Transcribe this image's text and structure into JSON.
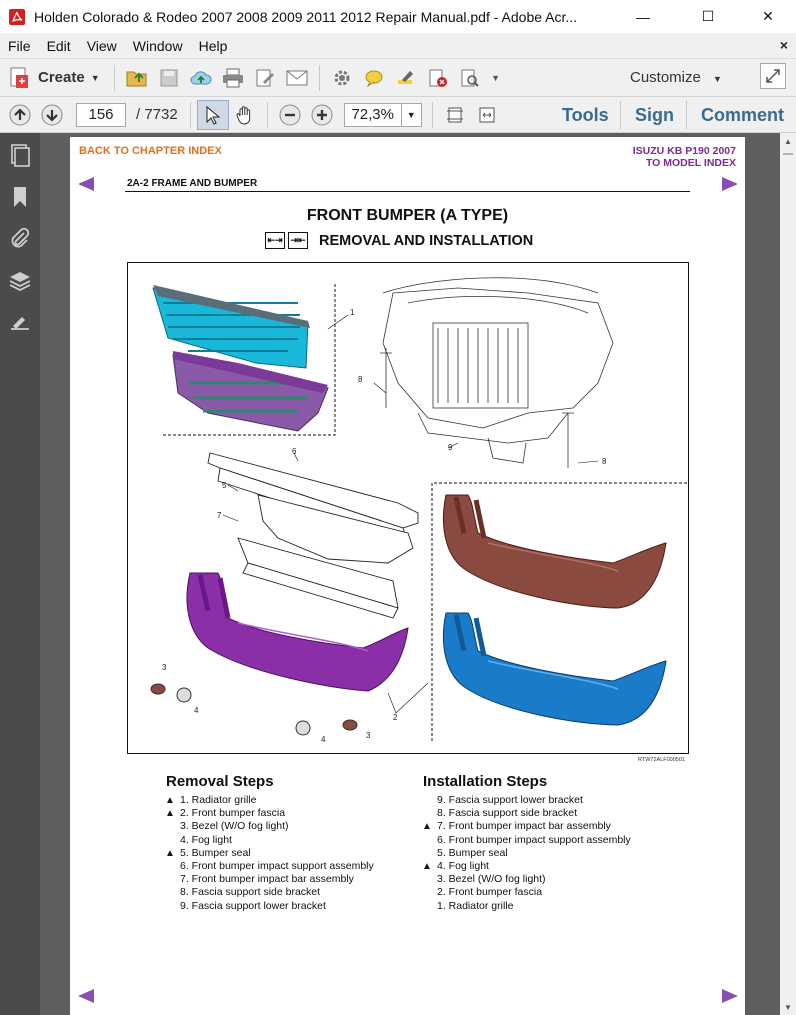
{
  "window": {
    "title": "Holden Colorado & Rodeo 2007 2008 2009 2011 2012 Repair Manual.pdf - Adobe Acr...",
    "minimize": "—",
    "maximize": "☐",
    "close": "✕"
  },
  "menu": {
    "items": [
      "File",
      "Edit",
      "View",
      "Window",
      "Help"
    ],
    "close": "×"
  },
  "toolbar": {
    "create_label": "Create",
    "customize_label": "Customize"
  },
  "nav": {
    "page_number": "156",
    "page_total": "/ 7732",
    "zoom": "72,3%",
    "tools_label": "Tools",
    "sign_label": "Sign",
    "comment_label": "Comment"
  },
  "page": {
    "back_link": "BACK TO CHAPTER INDEX",
    "model_line1": "ISUZU KB P190 2007",
    "model_line2": "TO MODEL INDEX",
    "section": "2A-2  FRAME AND BUMPER",
    "title": "FRONT BUMPER (A TYPE)",
    "subtitle": "REMOVAL AND INSTALLATION",
    "figure_code": "RTW72ALF000501",
    "callouts": [
      "1",
      "8",
      "9",
      "8",
      "6",
      "5",
      "7",
      "3",
      "4",
      "2",
      "4",
      "3"
    ]
  },
  "removal": {
    "heading": "Removal Steps",
    "steps": [
      {
        "mark": "▲",
        "text": "1. Radiator grille"
      },
      {
        "mark": "▲",
        "text": "2. Front bumper fascia"
      },
      {
        "mark": "",
        "text": "3. Bezel (W/O fog light)"
      },
      {
        "mark": "",
        "text": "4. Fog light"
      },
      {
        "mark": "▲",
        "text": "5. Bumper seal"
      },
      {
        "mark": "",
        "text": "6. Front bumper impact support assembly"
      },
      {
        "mark": "",
        "text": "7. Front bumper impact bar assembly"
      },
      {
        "mark": "",
        "text": "8. Fascia support side bracket"
      },
      {
        "mark": "",
        "text": "9. Fascia support lower bracket"
      }
    ]
  },
  "installation": {
    "heading": "Installation Steps",
    "steps": [
      {
        "mark": "",
        "text": "9. Fascia support lower bracket"
      },
      {
        "mark": "",
        "text": "8. Fascia support side bracket"
      },
      {
        "mark": "▲",
        "text": "7. Front bumper impact bar assembly"
      },
      {
        "mark": "",
        "text": "6. Front bumper impact support assembly"
      },
      {
        "mark": "",
        "text": "5. Bumper seal"
      },
      {
        "mark": "▲",
        "text": "4. Fog light"
      },
      {
        "mark": "",
        "text": "3. Bezel (W/O fog light)"
      },
      {
        "mark": "",
        "text": "2. Front bumper fascia"
      },
      {
        "mark": "",
        "text": "1. Radiator grille"
      }
    ]
  },
  "colors": {
    "back_link": "#e07020",
    "model_link": "#7a2a90",
    "nav_arrow": "#8a4fb0",
    "pane_link": "#3b6a8f",
    "grille_cyan": "#1ab8d8",
    "grille_purple": "#8a5aa8",
    "fascia_purple": "#8b2fa8",
    "fascia_brown": "#8b4a3f",
    "fascia_blue": "#1a7cc8"
  }
}
